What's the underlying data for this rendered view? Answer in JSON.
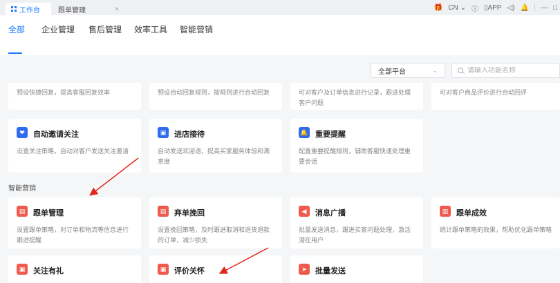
{
  "tabs": [
    {
      "label": "工作台",
      "active": true
    },
    {
      "label": "跟单管理",
      "close": "×"
    }
  ],
  "topbar": {
    "lang": "CN",
    "app": "APP"
  },
  "categories": [
    "全部",
    "企业管理",
    "售后管理",
    "效率工具",
    "智能营销"
  ],
  "filter": {
    "platform": "全部平台",
    "search_placeholder": "请输入功能名称"
  },
  "top_cards": [
    {
      "desc": "预设快捷回复，提高客服回复效率"
    },
    {
      "desc": "预设自动回复规则，按规则进行自动回复"
    },
    {
      "desc": "可对客户及订单信息进行记录，跟进处理客户问题"
    },
    {
      "desc": "可对客户商品评价进行自动回评"
    }
  ],
  "row2_cards": [
    {
      "title": "自动邀请关注",
      "desc": "设置关注策略，自动对客户发送关注邀请",
      "icon": "heart-chat-icon",
      "color": "#2f6bf0"
    },
    {
      "title": "进店接待",
      "desc": "自动发送欢迎语，提高买家服务体验和满意度",
      "icon": "chat-bubble-icon",
      "color": "#2f6bf0"
    },
    {
      "title": "重要提醒",
      "desc": "配置重要提醒规则，辅助客服快速处理重要会话",
      "icon": "bell-icon",
      "color": "#2f6bf0"
    }
  ],
  "section": {
    "title": "智能营销"
  },
  "row3_cards": [
    {
      "title": "跟单管理",
      "desc": "设置跟单策略，对订单和物流等信息进行跟进提醒",
      "icon": "document-icon",
      "color": "#ef5a4c"
    },
    {
      "title": "弃单挽回",
      "desc": "设置挽回策略，及时跟进取消和退货退款的订单，减少损失",
      "icon": "refund-doc-icon",
      "color": "#ef5a4c"
    },
    {
      "title": "消息广播",
      "desc": "批量发送消息，跟进买家问题处理，激活潜在用户",
      "icon": "megaphone-icon",
      "color": "#ef5a4c"
    },
    {
      "title": "跟单成效",
      "desc": "统计跟单策略的效果，帮助优化跟单策略",
      "icon": "chart-icon",
      "color": "#ef5a4c"
    }
  ],
  "row4_cards": [
    {
      "title": "关注有礼",
      "icon": "gift-icon",
      "color": "#ef5a4c"
    },
    {
      "title": "评价关怀",
      "icon": "gift-box-icon",
      "color": "#ef5a4c"
    },
    {
      "title": "批量发送",
      "icon": "send-icon",
      "color": "#ef5a4c"
    }
  ]
}
